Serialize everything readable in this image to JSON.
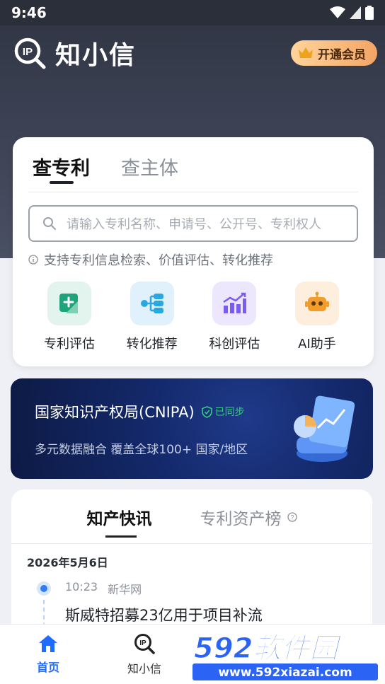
{
  "status_bar": {
    "time": "9:46"
  },
  "header": {
    "app_name": "知小信",
    "vip_label": "开通会员"
  },
  "search_tabs": [
    {
      "label": "查专利"
    },
    {
      "label": "查主体"
    }
  ],
  "search": {
    "placeholder": "请输入专利名称、申请号、公开号、专利权人"
  },
  "tip": "支持专利信息检索、价值评估、转化推荐",
  "features": [
    {
      "label": "专利评估",
      "icon": "patent-eval-icon",
      "color": "#1fa37a"
    },
    {
      "label": "转化推荐",
      "icon": "transform-icon",
      "color": "#2aa7e0"
    },
    {
      "label": "科创评估",
      "icon": "innovation-chart-icon",
      "color": "#7b5cf0"
    },
    {
      "label": "AI助手",
      "icon": "robot-icon",
      "color": "#f29c2b"
    }
  ],
  "banner": {
    "title": "国家知识产权局(CNIPA)",
    "synced": "已同步",
    "subtitle": "多元数据融合 覆盖全球100+ 国家/地区"
  },
  "news": {
    "tabs": [
      {
        "label": "知产快讯"
      },
      {
        "label": "专利资产榜"
      }
    ],
    "date": "2026年5月6日",
    "items": [
      {
        "time": "10:23",
        "source": "新华网",
        "headline": "斯威特招募23亿用于项目补流"
      }
    ]
  },
  "bottom_nav": [
    {
      "label": "首页",
      "icon": "home-icon"
    },
    {
      "label": "知小信",
      "icon": "ip-search-icon"
    }
  ],
  "watermark": {
    "text": "592软件园",
    "url_text": "www.592xiazai.com"
  }
}
